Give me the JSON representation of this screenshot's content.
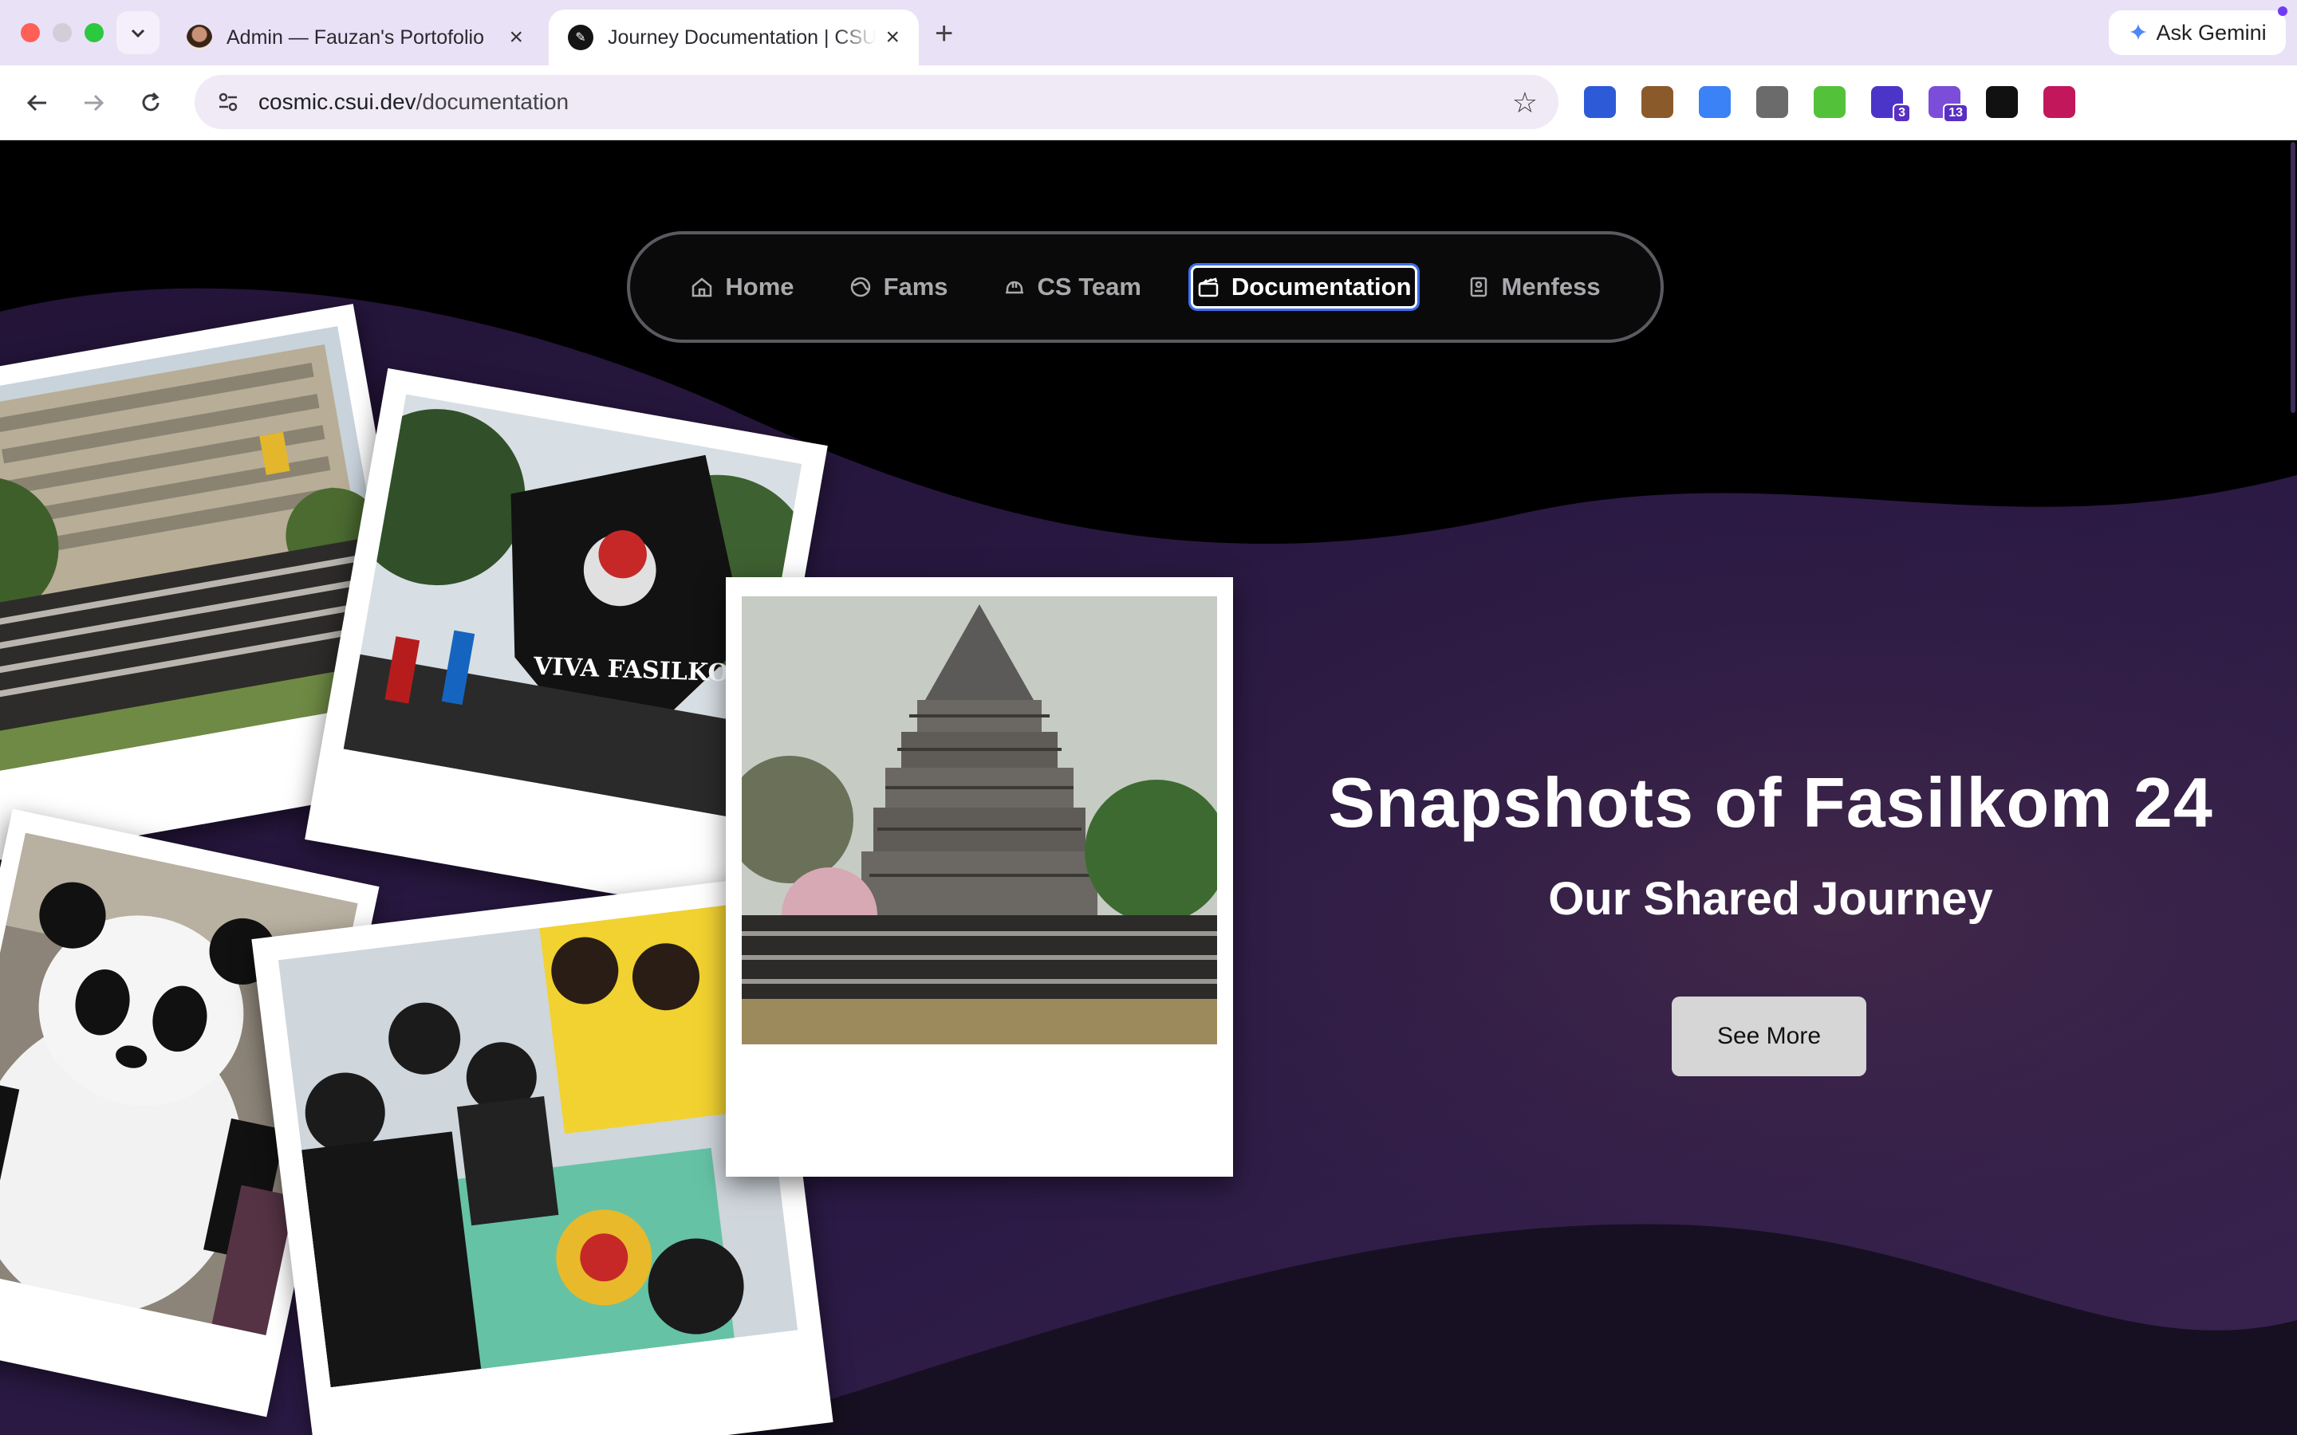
{
  "browser": {
    "tabs": [
      {
        "title": "Admin — Fauzan's Portofolio",
        "active": false
      },
      {
        "title": "Journey Documentation | CSUI",
        "active": true
      }
    ],
    "new_tab": "+",
    "ask_gemini": "Ask Gemini",
    "url_host": "cosmic.csui.dev",
    "url_path": "/documentation",
    "extensions": [
      {
        "name": "extension-1",
        "color": "#2d5bd8"
      },
      {
        "name": "cookie-extension",
        "color": "#8b5a2b"
      },
      {
        "name": "extension-3",
        "color": "#3b82f6"
      },
      {
        "name": "extension-4",
        "color": "#6b6b6b"
      },
      {
        "name": "extension-5",
        "color": "#53c23a"
      },
      {
        "name": "extension-6",
        "color": "#4b35c9",
        "badge": "3"
      },
      {
        "name": "extension-7",
        "color": "#7c4dd9",
        "badge": "13"
      },
      {
        "name": "extension-8",
        "color": "#111111"
      },
      {
        "name": "ublock-extension",
        "color": "#c2185b"
      }
    ]
  },
  "page": {
    "nav": {
      "home": "Home",
      "fams": "Fams",
      "cs_team": "CS Team",
      "documentation": "Documentation",
      "menfess": "Menfess"
    },
    "hero": {
      "title": "Snapshots of Fasilkom 24",
      "subtitle": "Our Shared Journey",
      "button": "See More"
    },
    "photo_text": {
      "flag": "VIVA FASILKOM"
    }
  },
  "colors": {
    "tabstrip": "#e9e1f5",
    "wave_purple": "#2a1a42",
    "wave_light": "#3a2554",
    "button_bg": "#d6d6d6",
    "active_outline": "#3b6ff0"
  }
}
